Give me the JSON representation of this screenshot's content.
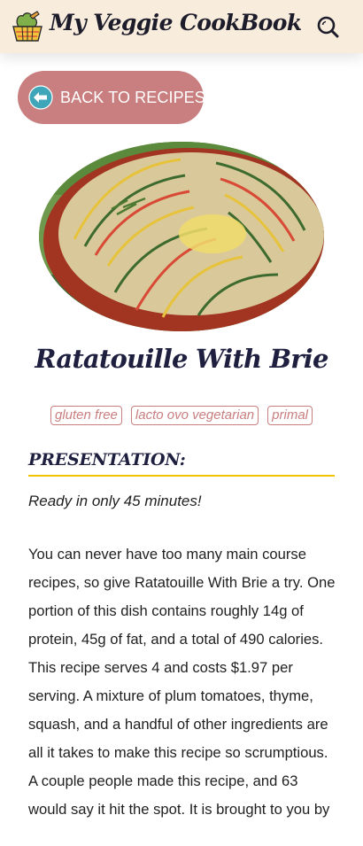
{
  "header": {
    "site_title": "My Veggie CookBook",
    "logo_icon": "veggie-basket-icon",
    "search_icon": "search-icon",
    "background": "#f8ecdd"
  },
  "back_button": {
    "label": "BACK TO RECIPES",
    "icon": "arrow-left-circle-icon",
    "color": "#c97f7f"
  },
  "recipe": {
    "image": "ratatouille-dish-photo",
    "title": "Ratatouille With Brie",
    "tags": [
      "gluten free",
      "lacto ovo vegetarian",
      "primal"
    ],
    "presentation_heading": "PRESENTATION:",
    "ready_text": "Ready in only 45 minutes!",
    "summary": "You can never have too many main course recipes, so give Ratatouille With Brie a try. One portion of this dish contains roughly 14g of protein, 45g of fat, and a total of 490 calories. This recipe serves 4 and costs $1.97 per serving. A mixture of plum tomatoes, thyme, squash, and a handful of other ingredients are all it takes to make this recipe so scrumptious. A couple people made this recipe, and 63 would say it hit the spot. It is brought to you by"
  },
  "colors": {
    "accent_rose": "#c97f7f",
    "heading_navy": "#1f2040",
    "underline_yellow": "#f2c400"
  }
}
